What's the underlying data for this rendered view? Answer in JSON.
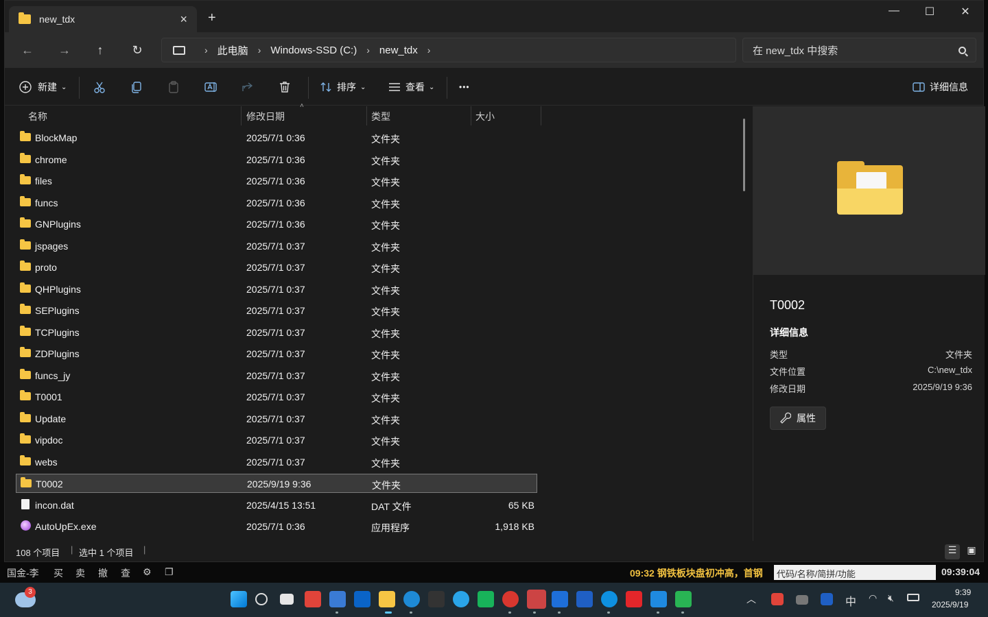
{
  "window": {
    "tab_title": "new_tdx",
    "new_tab": "+",
    "controls": {
      "minimize": "—",
      "maximize": "☐",
      "close": "✕"
    }
  },
  "nav": {
    "back": "←",
    "forward": "→",
    "up": "↑",
    "refresh": "↻",
    "breadcrumb": [
      "此电脑",
      "Windows-SSD (C:)",
      "new_tdx"
    ],
    "search_placeholder": "在 new_tdx 中搜索"
  },
  "toolbar": {
    "new_label": "新建",
    "sort_label": "排序",
    "view_label": "查看",
    "more_label": "•••",
    "details_label": "详细信息"
  },
  "columns": {
    "name": "名称",
    "date": "修改日期",
    "type": "类型",
    "size": "大小"
  },
  "files": [
    {
      "name": "BlockMap",
      "date": "2025/7/1 0:36",
      "type": "文件夹",
      "size": "",
      "icon": "folder-icon"
    },
    {
      "name": "chrome",
      "date": "2025/7/1 0:36",
      "type": "文件夹",
      "size": "",
      "icon": "folder-icon"
    },
    {
      "name": "files",
      "date": "2025/7/1 0:36",
      "type": "文件夹",
      "size": "",
      "icon": "folder-icon"
    },
    {
      "name": "funcs",
      "date": "2025/7/1 0:36",
      "type": "文件夹",
      "size": "",
      "icon": "folder-icon"
    },
    {
      "name": "GNPlugins",
      "date": "2025/7/1 0:36",
      "type": "文件夹",
      "size": "",
      "icon": "folder-icon"
    },
    {
      "name": "jspages",
      "date": "2025/7/1 0:37",
      "type": "文件夹",
      "size": "",
      "icon": "folder-icon"
    },
    {
      "name": "proto",
      "date": "2025/7/1 0:37",
      "type": "文件夹",
      "size": "",
      "icon": "folder-icon"
    },
    {
      "name": "QHPlugins",
      "date": "2025/7/1 0:37",
      "type": "文件夹",
      "size": "",
      "icon": "folder-icon"
    },
    {
      "name": "SEPlugins",
      "date": "2025/7/1 0:37",
      "type": "文件夹",
      "size": "",
      "icon": "folder-icon"
    },
    {
      "name": "TCPlugins",
      "date": "2025/7/1 0:37",
      "type": "文件夹",
      "size": "",
      "icon": "folder-icon"
    },
    {
      "name": "ZDPlugins",
      "date": "2025/7/1 0:37",
      "type": "文件夹",
      "size": "",
      "icon": "folder-icon"
    },
    {
      "name": "funcs_jy",
      "date": "2025/7/1 0:37",
      "type": "文件夹",
      "size": "",
      "icon": "folder-icon"
    },
    {
      "name": "T0001",
      "date": "2025/7/1 0:37",
      "type": "文件夹",
      "size": "",
      "icon": "folder-icon"
    },
    {
      "name": "Update",
      "date": "2025/7/1 0:37",
      "type": "文件夹",
      "size": "",
      "icon": "folder-icon"
    },
    {
      "name": "vipdoc",
      "date": "2025/7/1 0:37",
      "type": "文件夹",
      "size": "",
      "icon": "folder-icon"
    },
    {
      "name": "webs",
      "date": "2025/7/1 0:37",
      "type": "文件夹",
      "size": "",
      "icon": "folder-icon"
    },
    {
      "name": "T0002",
      "date": "2025/9/19 9:36",
      "type": "文件夹",
      "size": "",
      "icon": "folder-icon",
      "selected": true
    },
    {
      "name": "incon.dat",
      "date": "2025/4/15 13:51",
      "type": "DAT 文件",
      "size": "65 KB",
      "icon": "file-icon"
    },
    {
      "name": "AutoUpEx.exe",
      "date": "2025/7/1 0:36",
      "type": "应用程序",
      "size": "1,918 KB",
      "icon": "exe-icon"
    }
  ],
  "details": {
    "name": "T0002",
    "heading": "详细信息",
    "props": [
      {
        "key": "类型",
        "value": "文件夹"
      },
      {
        "key": "文件位置",
        "value": "C:\\new_tdx"
      },
      {
        "key": "修改日期",
        "value": "2025/9/19 9:36"
      }
    ],
    "properties_button": "属性"
  },
  "status": {
    "count": "108 个项目",
    "selected": "选中 1 个项目"
  },
  "background_app": {
    "left_items": [
      "国金-李",
      "买",
      "卖",
      "撤",
      "查"
    ],
    "ticker": "09:32 钢铁板块盘初冲高，首钢",
    "search_placeholder": "代码/名称/简拼/功能",
    "clock": "09:39:04"
  },
  "taskbar": {
    "badge": "3",
    "time": "9:39",
    "date": "2025/9/19",
    "ime": "中"
  }
}
